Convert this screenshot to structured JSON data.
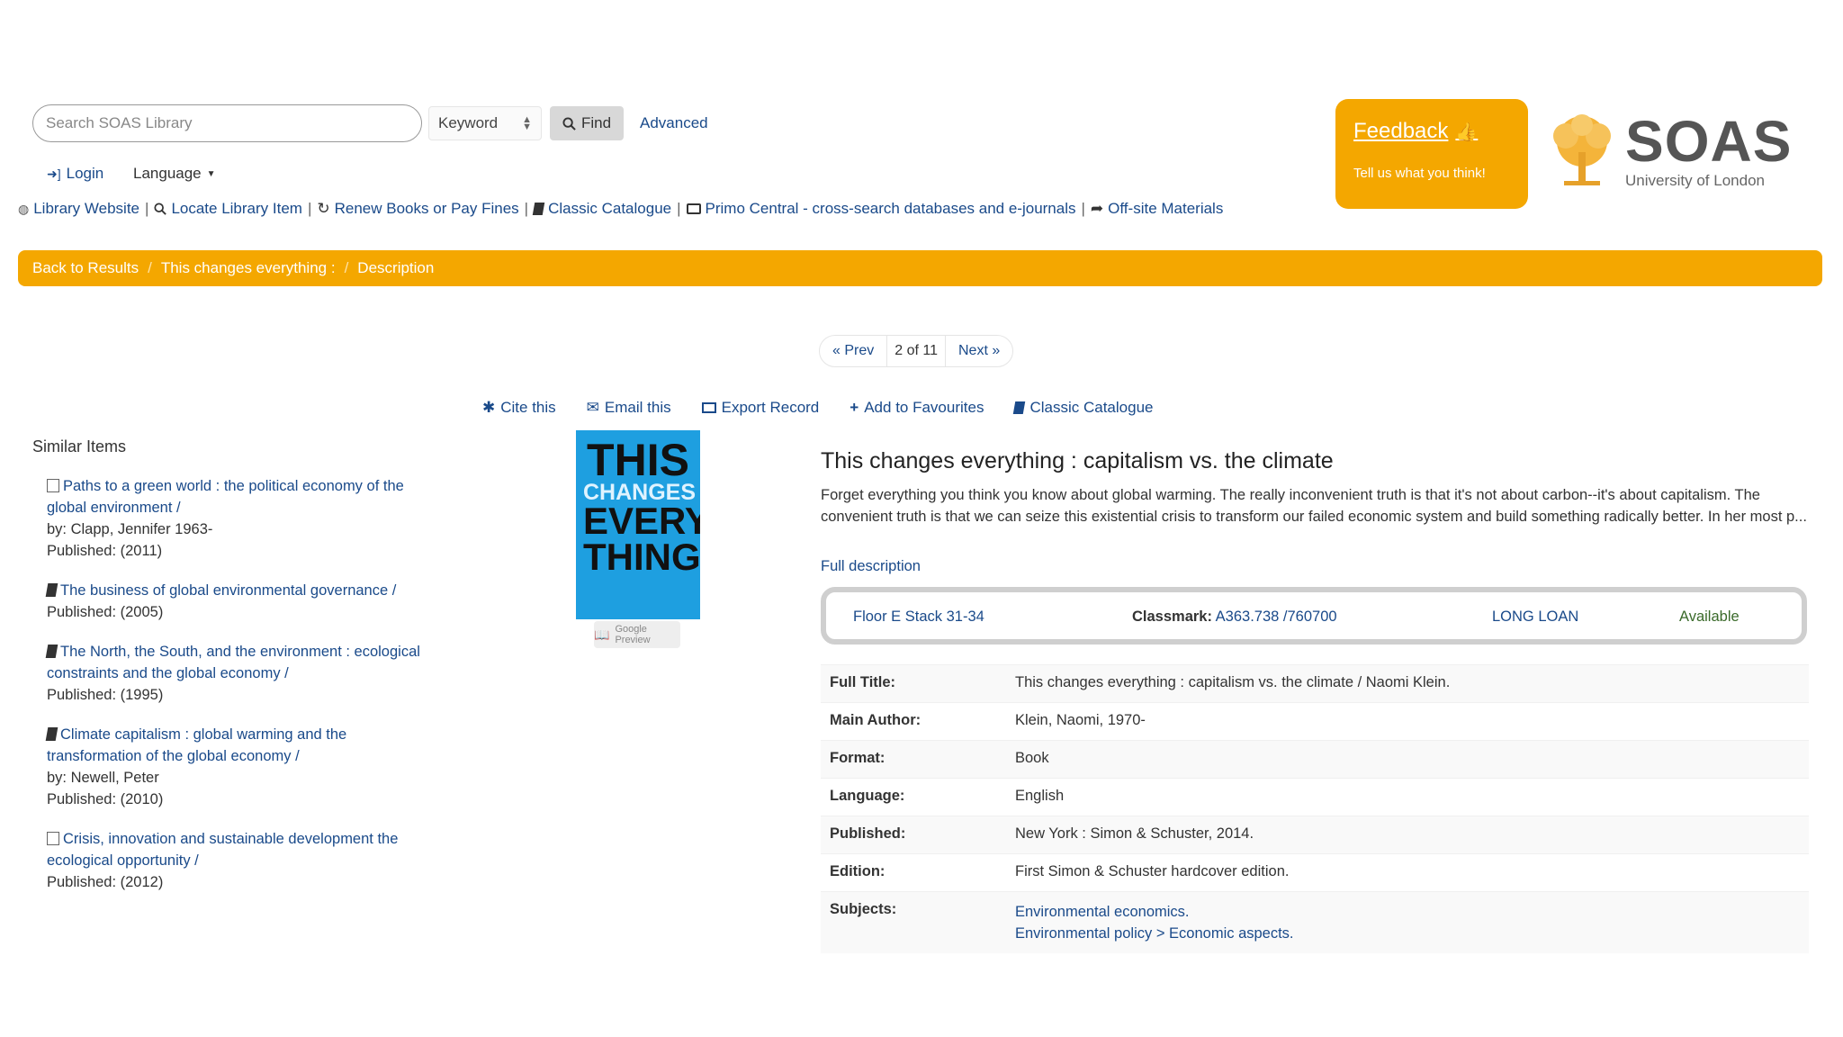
{
  "search": {
    "placeholder": "Search SOAS Library",
    "type": "Keyword",
    "find_label": "Find",
    "advanced_label": "Advanced"
  },
  "user": {
    "login_label": "Login",
    "language_label": "Language"
  },
  "quick_links": [
    {
      "label": "Library Website",
      "icon": "globe-icon"
    },
    {
      "label": "Locate Library Item",
      "icon": "search-icon"
    },
    {
      "label": "Renew Books or Pay Fines",
      "icon": "refresh-icon"
    },
    {
      "label": "Classic Catalogue",
      "icon": "book-icon"
    },
    {
      "label": "Primo Central - cross-search databases and e-journals",
      "icon": "monitor-icon"
    },
    {
      "label": "Off-site Materials",
      "icon": "share-icon"
    }
  ],
  "feedback": {
    "title": "Feedback",
    "subtitle": "Tell us what you think!"
  },
  "logo": {
    "name": "SOAS",
    "subtitle": "University of London"
  },
  "breadcrumb": {
    "back": "Back to Results",
    "title": "This changes everything :",
    "current": "Description"
  },
  "pager": {
    "prev": "« Prev",
    "count": "2 of 11",
    "next": "Next »"
  },
  "actions": {
    "cite": "Cite this",
    "email": "Email this",
    "export": "Export Record",
    "favourites": "Add to Favourites",
    "classic": "Classic Catalogue"
  },
  "similar": {
    "title": "Similar Items",
    "items": [
      {
        "title": "Paths to a green world : the political economy of the global environment /",
        "by": "by: Clapp, Jennifer 1963-",
        "published": "Published: (2011)",
        "icon": "ebook-icon"
      },
      {
        "title": "The business of global environmental governance /",
        "published": "Published: (2005)",
        "icon": "book-icon"
      },
      {
        "title": "The North, the South, and the environment : ecological constraints and the global economy /",
        "published": "Published: (1995)",
        "icon": "book-icon"
      },
      {
        "title": "Climate capitalism : global warming and the transformation of the global economy /",
        "by": "by: Newell, Peter",
        "published": "Published: (2010)",
        "icon": "book-icon"
      },
      {
        "title": "Crisis, innovation and sustainable development the ecological opportunity /",
        "published": "Published: (2012)",
        "icon": "ebook-icon"
      }
    ]
  },
  "cover": {
    "lines": [
      "THIS",
      "CHANGES",
      "EVERY",
      "THING"
    ],
    "preview": "Google Preview"
  },
  "record": {
    "title": "This changes everything : capitalism vs. the climate",
    "summary": "Forget everything you think you know about global warming. The really inconvenient truth is that it's not about carbon--it's about capitalism. The convenient truth is that we can seize this existential crisis to transform our failed economic system and build something radically better. In her most p...",
    "full_description": "Full description",
    "holdings": {
      "location": "Floor E Stack 31-34",
      "classmark_label": "Classmark:",
      "classmark": "A363.738 /760700",
      "loan": "LONG LOAN",
      "status": "Available"
    },
    "details": [
      {
        "label": "Full Title:",
        "value": "This changes everything : capitalism vs. the climate / Naomi Klein."
      },
      {
        "label": "Main Author:",
        "value": "Klein, Naomi, 1970-",
        "link": true
      },
      {
        "label": "Format:",
        "value": "Book"
      },
      {
        "label": "Language:",
        "value": "English"
      },
      {
        "label": "Published:",
        "value": "New York : Simon & Schuster, 2014."
      },
      {
        "label": "Edition:",
        "value": "First Simon & Schuster hardcover edition."
      },
      {
        "label": "Subjects:",
        "value": "Environmental economics.",
        "value2": "Environmental policy > Economic aspects.",
        "link": true
      }
    ]
  }
}
